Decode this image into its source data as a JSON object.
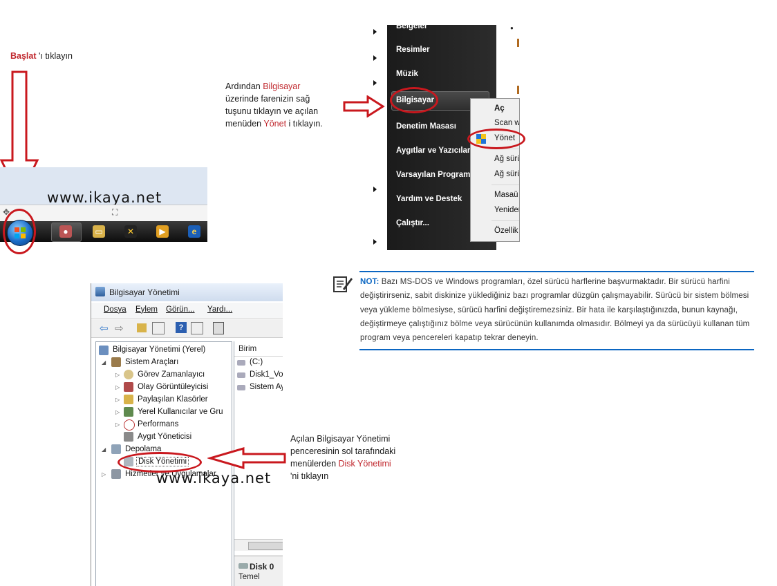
{
  "step1": {
    "prefix": "Başlat",
    "suffix": " 'ı tıklayın"
  },
  "step2": {
    "line1_a": "Ardından ",
    "line1_b": "Bilgisayar",
    "line2": "üzerinde farenizin sağ",
    "line3": "tuşunu tıklayın ve açılan",
    "line4_a": "menüden ",
    "line4_b": "Yönet",
    "line4_c": " i tıklayın."
  },
  "step3": {
    "line1": "Açılan Bilgisayar Yönetimi",
    "line2": "penceresinin sol tarafındaki",
    "line3_a": "menülerden ",
    "line3_b": "Disk Yönetimi",
    "line4": "'ni tıklayın"
  },
  "watermark": "www.ikaya.net",
  "start_menu": {
    "items": [
      "Belgeler",
      "Resimler",
      "Müzik",
      "Bilgisayar",
      "Denetim Masası",
      "Aygıtlar ve Yazıcılar",
      "Varsayılan Programlar",
      "Yardım ve Destek",
      "Çalıştır..."
    ]
  },
  "context_menu": {
    "items": [
      "Aç",
      "Scan w",
      "Yönet",
      "Ağ sürü",
      "Ağ sürü",
      "Masaü",
      "Yeniden",
      "Özellik"
    ]
  },
  "note": {
    "label": "NOT:",
    "text": " Bazı MS-DOS ve Windows programları, özel sürücü harflerine başvurmaktadır. Bir sürücü harfini değiştirirseniz, sabit diskinize yüklediğiniz bazı programlar düzgün çalışmayabilir. Sürücü bir sistem bölmesi veya yükleme bölmesiyse, sürücü harfini değiştiremezsiniz. Bir hata ile karşılaştığınızda, bunun kaynağı, değiştirmeye çalıştığınız bölme veya sürücünün kullanımda olmasıdır. Bölmeyi ya da sürücüyü kullanan tüm program veya pencereleri kapatıp tekrar deneyin."
  },
  "window": {
    "title": "Bilgisayar Yönetimi",
    "menu": [
      "Dosya",
      "Eylem",
      "Görün...",
      "Yardı..."
    ],
    "tree": {
      "root": "Bilgisayar Yönetimi (Yerel)",
      "system_tools": "Sistem Araçları",
      "task_scheduler": "Görev Zamanlayıcı",
      "event_viewer": "Olay Görüntüleyicisi",
      "shared_folders": "Paylaşılan Klasörler",
      "local_users": "Yerel Kullanıcılar ve Gru",
      "performance": "Performans",
      "device_manager": "Aygıt Yöneticisi",
      "storage": "Depolama",
      "disk_management": "Disk Yönetimi",
      "services": "Hizmetler ve Uygulamalar"
    },
    "right": {
      "header": "Birim",
      "rows": [
        "(C:)",
        "Disk1_Vol",
        "Sistem Ay"
      ],
      "disk_label": "Disk 0",
      "disk_type": "Temel"
    }
  },
  "colors": {
    "accent_red": "#c0272d",
    "note_blue": "#0b66c2"
  }
}
